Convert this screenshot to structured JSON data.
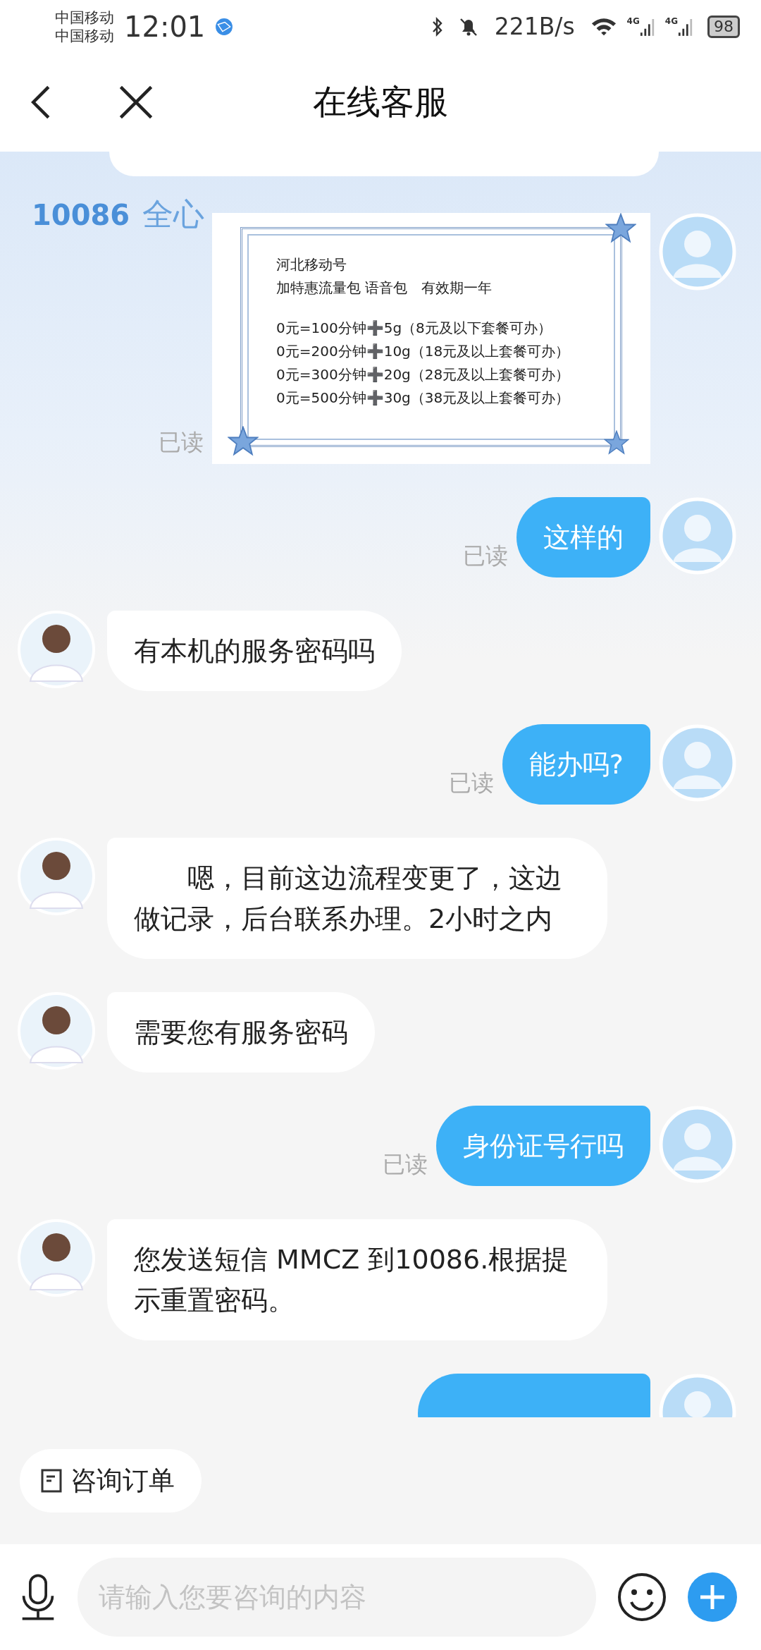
{
  "status_bar": {
    "carriers": [
      "中国移动",
      "中国移动"
    ],
    "time": "12:01",
    "net_speed": "221B/s",
    "signals": [
      {
        "label": "4G"
      },
      {
        "label": "4G"
      }
    ],
    "battery": "98"
  },
  "header": {
    "title": "在线客服"
  },
  "banner": {
    "number": "10086",
    "slogan": "全心"
  },
  "messages": [
    {
      "kind": "user_image",
      "status": "已读",
      "heading_lines": [
        "河北移动号",
        "加特惠流量包 语音包　有效期一年"
      ],
      "offer_lines": [
        "0元=100分钟➕5g（8元及以下套餐可办）",
        "0元=200分钟➕10g（18元及以上套餐可办）",
        "0元=300分钟➕20g（28元及以上套餐可办）",
        "0元=500分钟➕30g（38元及以上套餐可办）"
      ]
    },
    {
      "kind": "user_text",
      "status": "已读",
      "text": "这样的"
    },
    {
      "kind": "agent_text",
      "text": "有本机的服务密码吗"
    },
    {
      "kind": "user_text",
      "status": "已读",
      "text": "能办吗?"
    },
    {
      "kind": "agent_text",
      "text": "　　嗯，目前这边流程变更了，这边做记录，后台联系办理。2小时之内"
    },
    {
      "kind": "agent_text",
      "text": "需要您有服务密码"
    },
    {
      "kind": "user_text",
      "status": "已读",
      "text": "身份证号行吗"
    },
    {
      "kind": "agent_text",
      "text": "您发送短信 MMCZ 到10086.根据提示重置密码。"
    },
    {
      "kind": "user_cut_off"
    }
  ],
  "quick_actions": [
    {
      "label": "咨询订单"
    }
  ],
  "input": {
    "placeholder": "请输入您要咨询的内容"
  }
}
